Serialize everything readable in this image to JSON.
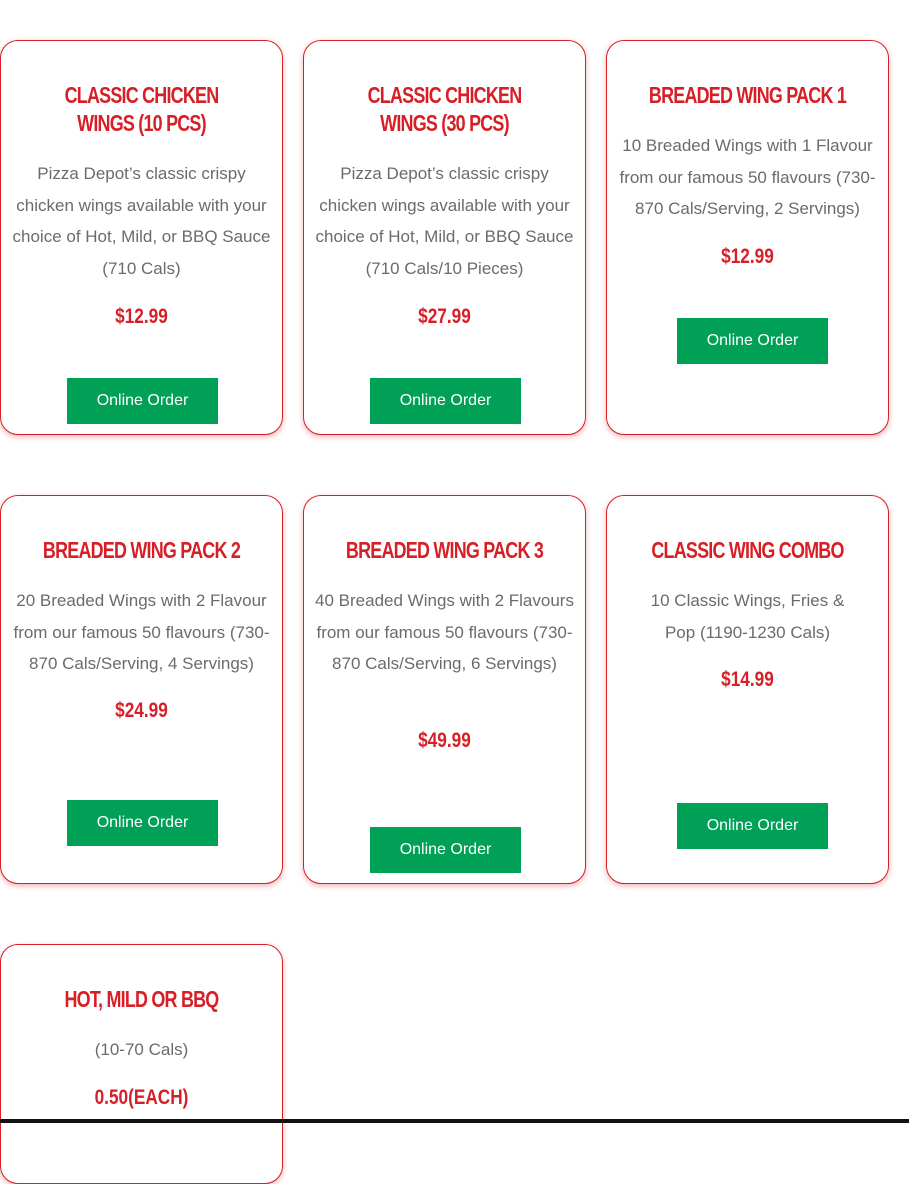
{
  "colors": {
    "accent": "#d61f26",
    "button": "#00a056",
    "button_text": "#ffffff",
    "description": "#6b6b6b"
  },
  "menu": {
    "items": [
      {
        "title": "CLASSIC CHICKEN WINGS (10 PCS)",
        "description": "Pizza Depot’s classic crispy chicken wings available with your choice of Hot, Mild, or BBQ Sauce (710 Cals)",
        "price": "$12.99",
        "button_label": "Online Order"
      },
      {
        "title": "CLASSIC CHICKEN WINGS (30 PCS)",
        "description": "Pizza Depot’s classic crispy chicken wings available with your choice of Hot, Mild, or BBQ Sauce (710 Cals/10 Pieces)",
        "price": "$27.99",
        "button_label": "Online Order"
      },
      {
        "title": "BREADED WING PACK 1",
        "description": "10 Breaded Wings with 1 Flavour from our famous 50 flavours (730-870 Cals/Serving, 2 Servings)",
        "price": "$12.99",
        "button_label": "Online Order"
      },
      {
        "title": "BREADED WING PACK 2",
        "description": "20 Breaded Wings with 2 Flavour from our famous 50 flavours (730-870 Cals/Serving, 4 Servings)",
        "price": "$24.99",
        "button_label": "Online Order"
      },
      {
        "title": "BREADED WING PACK 3",
        "description": "40 Breaded Wings with 2 Flavours from our famous 50 flavours (730-870 Cals/Serving, 6 Servings)",
        "price": "$49.99",
        "button_label": "Online Order"
      },
      {
        "title": "CLASSIC WING COMBO",
        "description": "10 Classic Wings, Fries & Pop (1190-1230 Cals)",
        "price": "$14.99",
        "button_label": "Online Order"
      },
      {
        "title": "HOT, MILD OR BBQ",
        "description": "(10-70 Cals)",
        "price": "0.50(EACH)"
      }
    ]
  }
}
